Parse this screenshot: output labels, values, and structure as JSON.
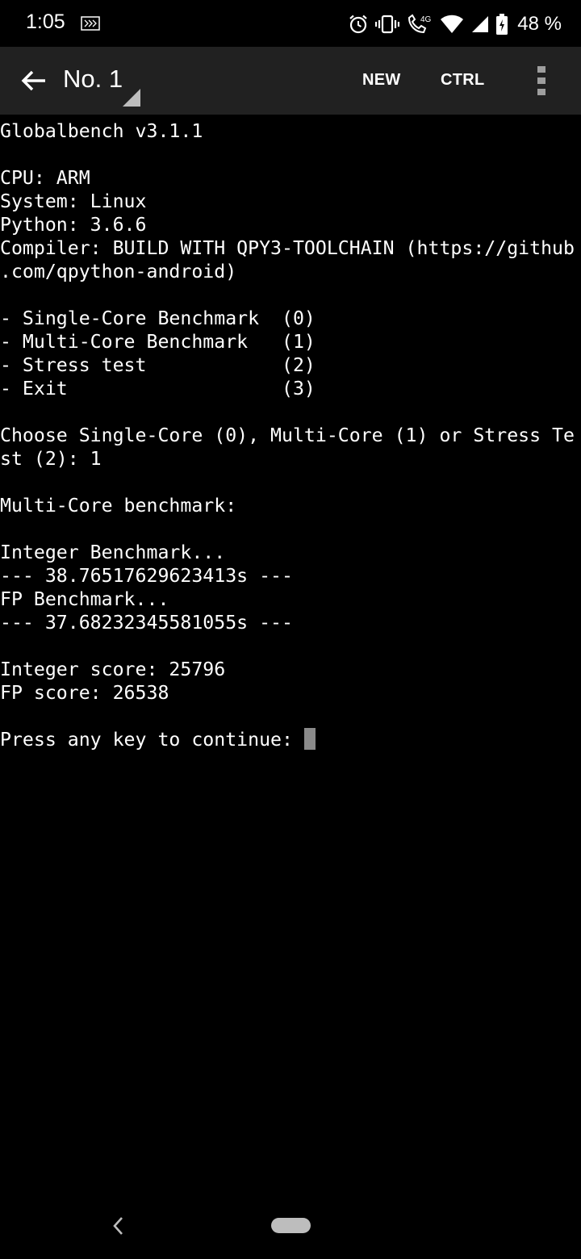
{
  "status_bar": {
    "time": "1:05",
    "battery_percent": "48 %",
    "network_label": "4G",
    "icons": [
      "notification-icon",
      "alarm-icon",
      "vibrate-icon",
      "volte-call-icon",
      "wifi-icon",
      "signal-icon",
      "battery-icon"
    ]
  },
  "toolbar": {
    "title": "No. 1",
    "new_label": "NEW",
    "ctrl_label": "CTRL",
    "icons": [
      "back-arrow-icon",
      "spinner-triangle-icon",
      "more-vert-icon"
    ]
  },
  "terminal": {
    "lines": [
      "Globalbench v3.1.1",
      "",
      "CPU: ARM",
      "System: Linux",
      "Python: 3.6.6",
      "Compiler: BUILD WITH QPY3-TOOLCHAIN (https://github",
      ".com/qpython-android)",
      "",
      "- Single-Core Benchmark  (0)",
      "- Multi-Core Benchmark   (1)",
      "- Stress test            (2)",
      "- Exit                   (3)",
      "",
      "Choose Single-Core (0), Multi-Core (1) or Stress Te",
      "st (2): 1",
      "",
      "Multi-Core benchmark:",
      "",
      "Integer Benchmark...",
      "--- 38.76517629623413s ---",
      "FP Benchmark...",
      "--- 37.68232345581055s ---",
      "",
      "Integer score: 25796",
      "FP score: 26538",
      "",
      "Press any key to continue: "
    ]
  },
  "nav_bar": {
    "icons": [
      "nav-back-icon",
      "nav-home-pill-icon"
    ]
  },
  "colors": {
    "background": "#000000",
    "toolbar": "#212121",
    "text": "#ffffff",
    "cursor": "#8a8a8a"
  }
}
